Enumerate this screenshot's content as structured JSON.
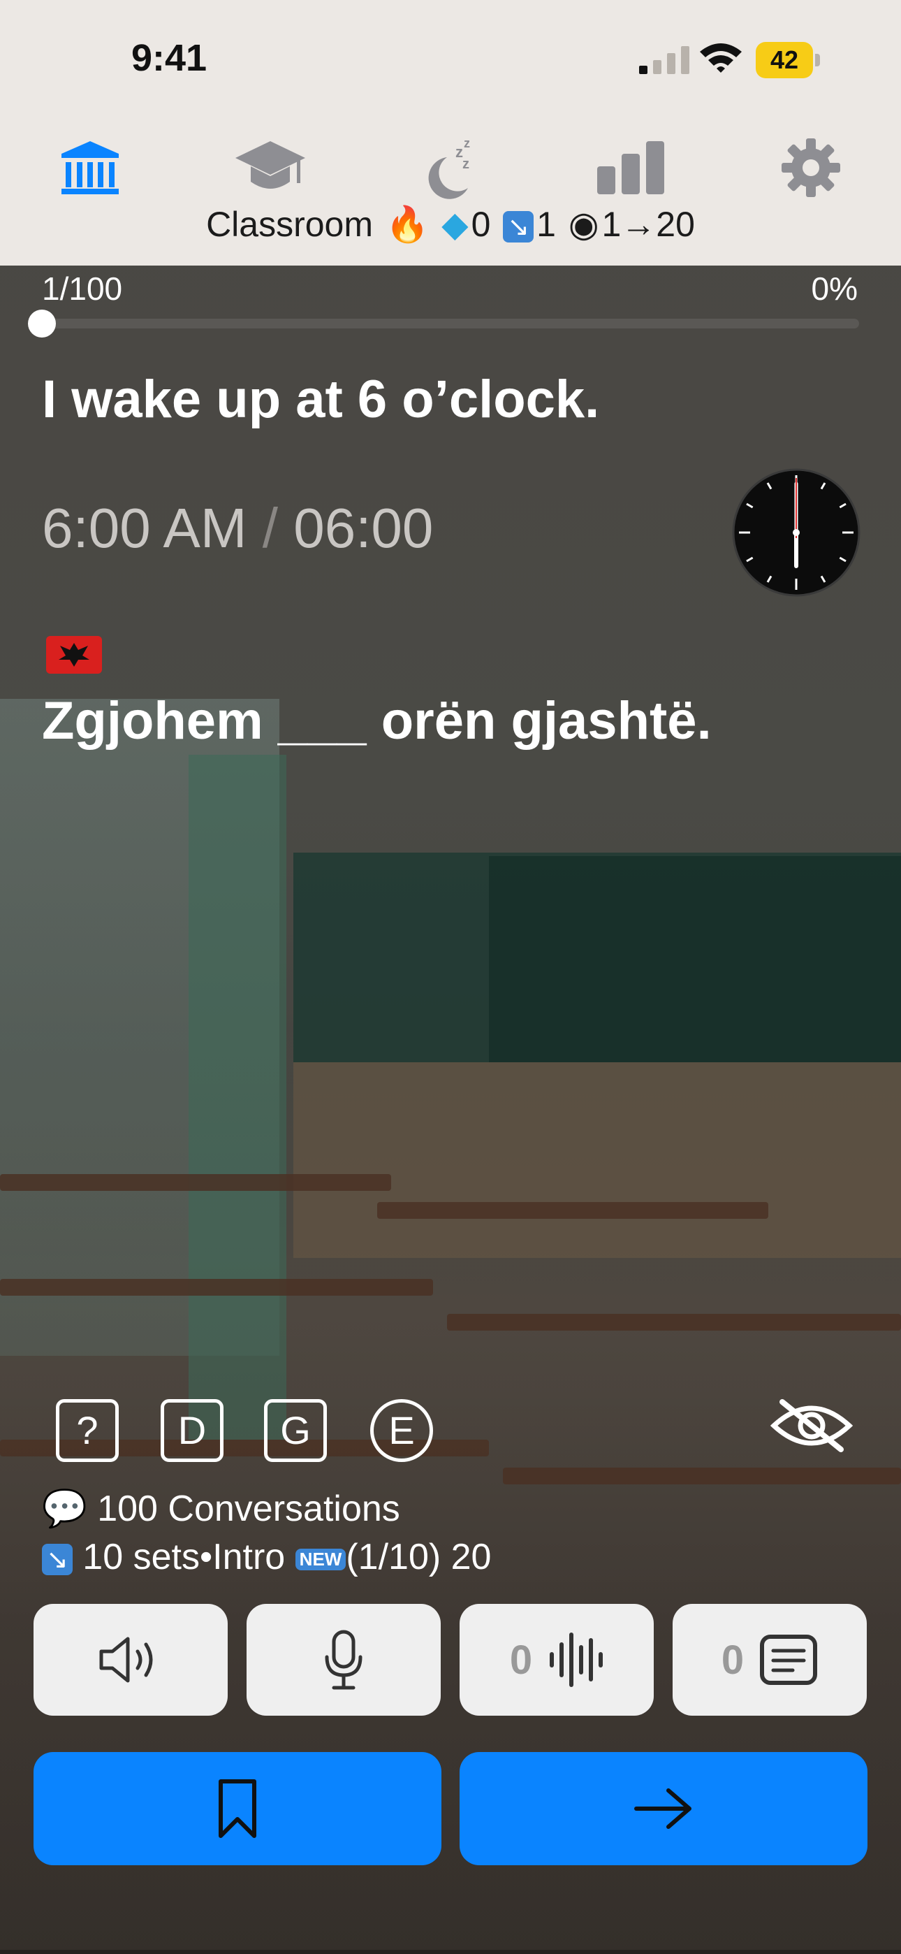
{
  "status_bar": {
    "time": "9:41",
    "battery_level": "42"
  },
  "nav": {
    "tabs": [
      {
        "name": "classroom",
        "icon": "bank-icon",
        "active": true,
        "color": "#0a84ff"
      },
      {
        "name": "learn",
        "icon": "graduation-cap-icon",
        "active": false,
        "color": "#8e8e93"
      },
      {
        "name": "sleep",
        "icon": "moon-zzz-icon",
        "active": false,
        "color": "#8e8e93"
      },
      {
        "name": "stats",
        "icon": "bar-chart-icon",
        "active": false,
        "color": "#8e8e93"
      },
      {
        "name": "settings",
        "icon": "gear-icon",
        "active": false,
        "color": "#8e8e93"
      }
    ],
    "title": "Classroom",
    "streak_emoji": "🔥",
    "gems": "0",
    "review": "1",
    "views": "1→20"
  },
  "progress": {
    "position": "1/100",
    "percent": "0%",
    "fraction": 0.0
  },
  "lesson": {
    "english": "I wake up at 6 o’clock.",
    "time_12h": "6:00 AM",
    "separator": "/",
    "time_24h": "06:00",
    "clock_hour": 6,
    "clock_minute": 0,
    "target_flag": "albania-flag-icon",
    "target_sentence": "Zgjohem ___ orën gjashtë."
  },
  "tools": [
    "?",
    "D",
    "G",
    "E"
  ],
  "info": {
    "conversations_emoji": "💬",
    "conversations": "100 Conversations",
    "sets_emoji": "↘",
    "sets": "10 sets•Intro",
    "new_badge": "NEW",
    "new_progress": "(1/10) 20"
  },
  "actions": {
    "recordings_count": "0",
    "transcripts_count": "0"
  },
  "colors": {
    "accent": "#0a84ff",
    "nav_background": "#ece8e4"
  }
}
